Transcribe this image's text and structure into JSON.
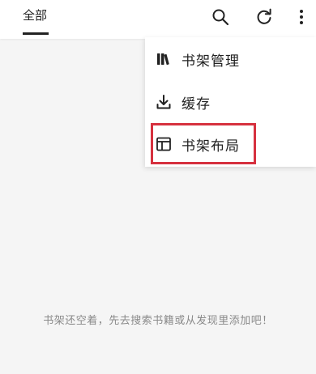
{
  "header": {
    "tab_label": "全部",
    "icons": {
      "search": "search-icon",
      "refresh": "refresh-icon",
      "more": "more-vert-icon"
    }
  },
  "menu": {
    "items": [
      {
        "label": "书架管理",
        "icon": "books-icon"
      },
      {
        "label": "缓存",
        "icon": "download-icon"
      },
      {
        "label": "书架布局",
        "icon": "layout-icon"
      }
    ],
    "highlight_color": "#d6313f"
  },
  "empty": {
    "message": "书架还空着，先去搜索书籍或从发现里添加吧！"
  }
}
